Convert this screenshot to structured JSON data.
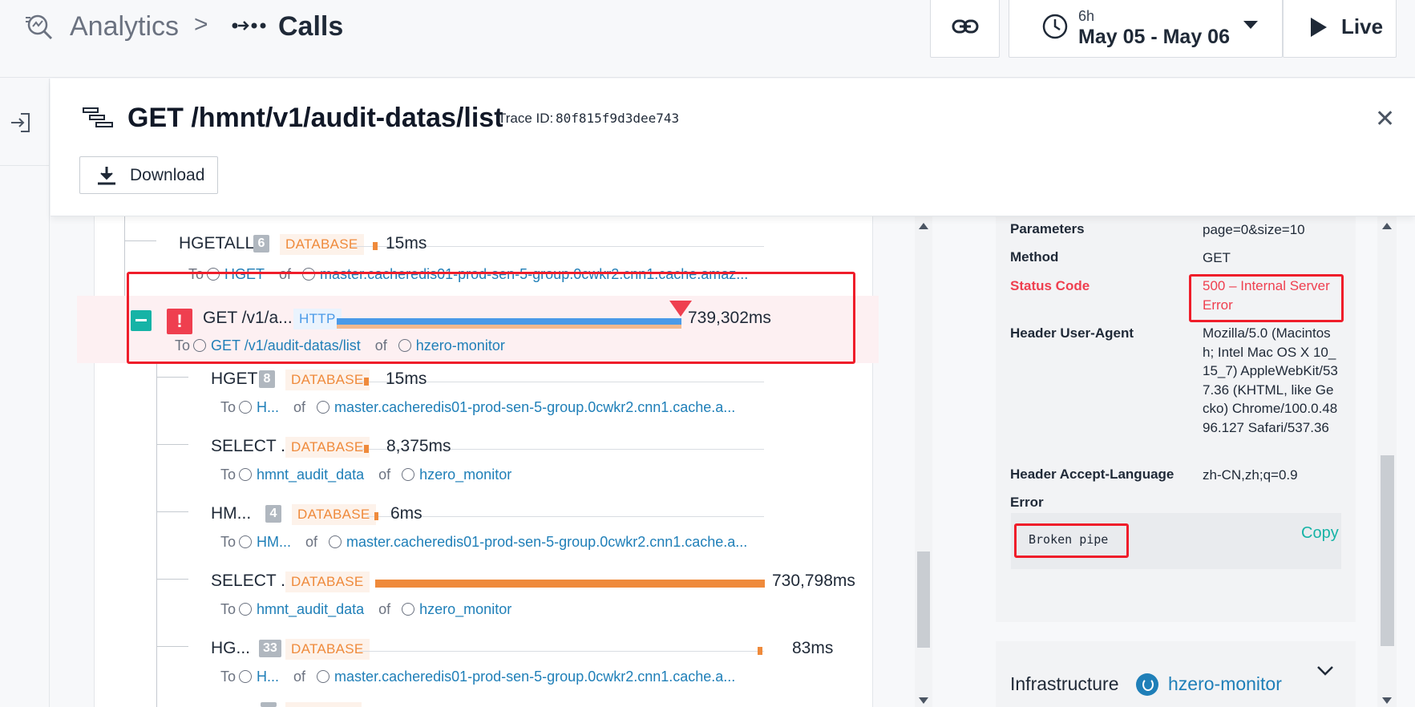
{
  "header": {
    "breadcrumb_root": "Analytics",
    "breadcrumb_separator": ">",
    "breadcrumb_current": "Calls",
    "time_range": {
      "duration": "6h",
      "dates": "May 05 - May 06"
    },
    "live_label": "Live"
  },
  "panel": {
    "title": "GET /hmnt/v1/audit-datas/list",
    "trace_label": "Trace ID:",
    "trace_id": "80f815f9d3dee743",
    "download_label": "Download",
    "close_label": "✕"
  },
  "spans": [
    {
      "name": "HGETALL",
      "count": "6",
      "type": "DATABASE",
      "duration": "15ms",
      "to_label": "To",
      "to_name": "HGET",
      "of_label": "of",
      "of_name": "master.cacheredis01-prod-sen-5-group.0cwkr2.cnn1.cache.amaz..."
    },
    {
      "name": "GET /v1/a...",
      "type": "HTTP",
      "duration": "739,302ms",
      "to_label": "To",
      "to_name": "GET /v1/audit-datas/list",
      "of_label": "of",
      "of_name": "hzero-monitor",
      "error_badge": "!"
    },
    {
      "name": "HGET",
      "count": "8",
      "type": "DATABASE",
      "duration": "15ms",
      "to_label": "To",
      "to_name": "H...",
      "of_label": "of",
      "of_name": "master.cacheredis01-prod-sen-5-group.0cwkr2.cnn1.cache.a..."
    },
    {
      "name": "SELECT ...",
      "type": "DATABASE",
      "duration": "8,375ms",
      "to_label": "To",
      "to_name": "hmnt_audit_data",
      "of_label": "of",
      "of_name": "hzero_monitor"
    },
    {
      "name": "HM...",
      "count": "4",
      "type": "DATABASE",
      "duration": "6ms",
      "to_label": "To",
      "to_name": "HM...",
      "of_label": "of",
      "of_name": "master.cacheredis01-prod-sen-5-group.0cwkr2.cnn1.cache.a..."
    },
    {
      "name": "SELECT ...",
      "type": "DATABASE",
      "duration": "730,798ms",
      "to_label": "To",
      "to_name": "hmnt_audit_data",
      "of_label": "of",
      "of_name": "hzero_monitor"
    },
    {
      "name": "HG...",
      "count": "33",
      "type": "DATABASE",
      "duration": "83ms",
      "to_label": "To",
      "to_name": "H...",
      "of_label": "of",
      "of_name": "master.cacheredis01-prod-sen-5-group.0cwkr2.cnn1.cache.a..."
    }
  ],
  "details": {
    "rows": [
      {
        "label": "Parameters",
        "value": "page=0&size=10"
      },
      {
        "label": "Method",
        "value": "GET"
      },
      {
        "label": "Status Code",
        "value": "500 – Internal Server Error"
      },
      {
        "label": "Header User-Agent",
        "value": "Mozilla/5.0 (Macintosh; Intel Mac OS X 10_15_7) AppleWebKit/537.36 (KHTML, like Gecko) Chrome/100.0.4896.127 Safari/537.36"
      },
      {
        "label": "Header Accept-Language",
        "value": "zh-CN,zh;q=0.9"
      }
    ],
    "error_label": "Error",
    "error_text": "Broken pipe",
    "copy_label": "Copy",
    "infra_label": "Infrastructure",
    "infra_name": "hzero-monitor"
  },
  "colors": {
    "accent_teal": "#16b3a6",
    "error_red": "#ef3f4f",
    "db_orange": "#ef8a3b",
    "http_blue": "#4a9ae8",
    "link_blue": "#1f7fb8",
    "highlight_box": "#ef1d2a"
  }
}
